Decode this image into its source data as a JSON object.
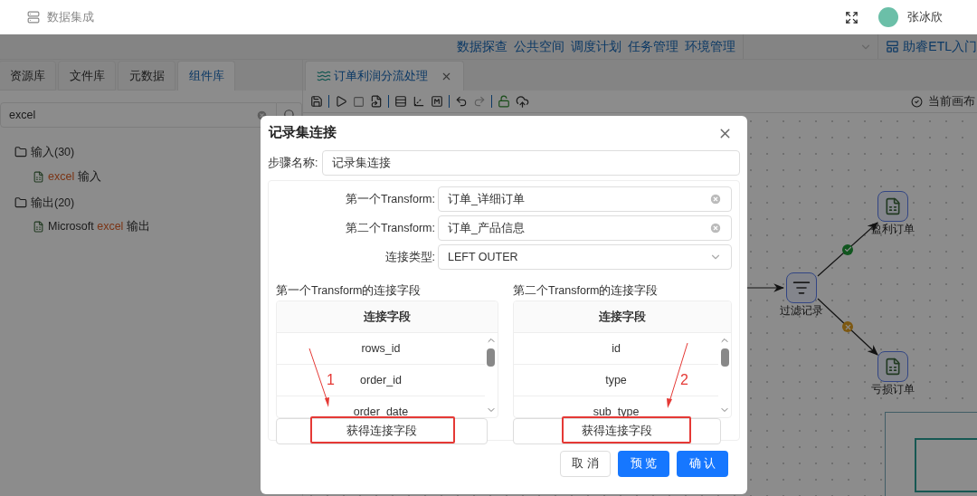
{
  "header": {
    "title": "数据集成",
    "user": "张冰欣"
  },
  "nav": [
    "数据探查",
    "公共空间",
    "调度计划",
    "任务管理",
    "环境管理"
  ],
  "guide_link": "助睿ETL入门",
  "left_tabs": [
    {
      "label": "资源库",
      "selected": false
    },
    {
      "label": "文件库",
      "selected": false
    },
    {
      "label": "元数据",
      "selected": false
    },
    {
      "label": "组件库",
      "selected": true
    }
  ],
  "search": {
    "value": "excel"
  },
  "tree": [
    {
      "label": "输入(30)",
      "children": [
        {
          "match": "excel",
          "after": "输入"
        }
      ]
    },
    {
      "label": "输出(20)",
      "children": [
        {
          "before": "Microsoft",
          "match": "excel",
          "after": "输出"
        }
      ]
    }
  ],
  "canvas_tab": {
    "title": "订单利润分流处理"
  },
  "canvas_status": "当前画布",
  "nodes": [
    {
      "label": "盈利订单",
      "kind": "excel"
    },
    {
      "label": "过滤记录",
      "kind": "filter"
    },
    {
      "label": "亏损订单",
      "kind": "excel"
    }
  ],
  "edges": [
    {
      "passed": true
    },
    {
      "passed": false
    }
  ],
  "dialog": {
    "title": "记录集连接",
    "step_name": {
      "label": "步骤名称:",
      "value": "记录集连接"
    },
    "fields": [
      {
        "label": "第一个Transform:",
        "value": "订单_详细订单",
        "kind": "clearable"
      },
      {
        "label": "第二个Transform:",
        "value": "订单_产品信息",
        "kind": "clearable"
      },
      {
        "label": "连接类型:",
        "value": "LEFT OUTER",
        "kind": "dropdown"
      }
    ],
    "tables": [
      {
        "title": "第一个Transform的连接字段",
        "column": "连接字段",
        "rows": [
          "rows_id",
          "order_id",
          "order_date"
        ],
        "button": "获得连接字段",
        "annotation": "1"
      },
      {
        "title": "第二个Transform的连接字段",
        "column": "连接字段",
        "rows": [
          "id",
          "type",
          "sub_type"
        ],
        "button": "获得连接字段",
        "annotation": "2"
      }
    ],
    "buttons": [
      {
        "label": "取 消",
        "kind": "default"
      },
      {
        "label": "预 览",
        "kind": "primary"
      },
      {
        "label": "确 认",
        "kind": "primary"
      }
    ]
  }
}
